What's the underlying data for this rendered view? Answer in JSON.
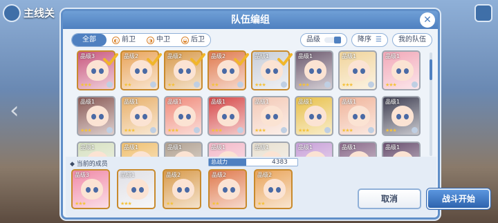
{
  "background": {
    "title": "主线关"
  },
  "dialog": {
    "title": "队伍编组",
    "tabs": [
      {
        "label": "全部",
        "active": true
      },
      {
        "label": "前卫"
      },
      {
        "label": "中卫"
      },
      {
        "label": "后卫"
      }
    ],
    "filters": {
      "rank_label": "品级",
      "sort_label": "降序",
      "myteam_label": "我的队伍"
    },
    "characters": [
      {
        "level": "品级3",
        "stars": "★★★",
        "selected": true,
        "bg": "#c9577e"
      },
      {
        "level": "品级2",
        "stars": "★★",
        "selected": true,
        "bg": "#e9a45a"
      },
      {
        "level": "品级2",
        "stars": "★★",
        "selected": true,
        "bg": "#d89a4b"
      },
      {
        "level": "品级2",
        "stars": "★★",
        "selected": true,
        "bg": "#e07a4e"
      },
      {
        "level": "品级1",
        "stars": "★★★",
        "selected": true,
        "bg": "#c9ced8"
      },
      {
        "level": "品级1",
        "stars": "★★★",
        "selected": false,
        "bg": "#6d5a6f"
      },
      {
        "level": "品级1",
        "stars": "★★★",
        "selected": false,
        "bg": "#f1d49b"
      },
      {
        "level": "品级1",
        "stars": "★★★",
        "selected": false,
        "bg": "#f2a8b8"
      },
      {
        "level": "品级1",
        "stars": "★★★",
        "selected": false,
        "bg": "#8a5a55"
      },
      {
        "level": "品级1",
        "stars": "★★★",
        "selected": false,
        "bg": "#e8b06a"
      },
      {
        "level": "品级1",
        "stars": "★★★",
        "selected": false,
        "bg": "#f08a7a"
      },
      {
        "level": "品级1",
        "stars": "★★★",
        "selected": false,
        "bg": "#d64848"
      },
      {
        "level": "品级1",
        "stars": "★★★",
        "selected": false,
        "bg": "#f3c9b6"
      },
      {
        "level": "品级1",
        "stars": "★★★",
        "selected": false,
        "bg": "#e8c04a"
      },
      {
        "level": "品级1",
        "stars": "★★★",
        "selected": false,
        "bg": "#f0b49a"
      },
      {
        "level": "品级1",
        "stars": "★★★",
        "selected": false,
        "bg": "#3f3f52"
      },
      {
        "level": "品级1",
        "stars": "",
        "selected": false,
        "bg": "#d6e0c0"
      },
      {
        "level": "品级1",
        "stars": "",
        "selected": false,
        "bg": "#f0c070"
      },
      {
        "level": "品级1",
        "stars": "",
        "selected": false,
        "bg": "#b0a090"
      },
      {
        "level": "品级1",
        "stars": "",
        "selected": false,
        "bg": "#f3b8c8"
      },
      {
        "level": "品级1",
        "stars": "",
        "selected": false,
        "bg": "#e8e0d0"
      },
      {
        "level": "品级1",
        "stars": "",
        "selected": false,
        "bg": "#c8a0d8"
      },
      {
        "level": "品级1",
        "stars": "",
        "selected": false,
        "bg": "#8a6a8a"
      },
      {
        "level": "品级1",
        "stars": "",
        "selected": false,
        "bg": "#6a5070"
      }
    ],
    "current": {
      "label": "当前的成员",
      "power_label": "总战力",
      "power_value": "4383",
      "members": [
        {
          "level": "品级3",
          "stars": "★★★",
          "bg": "#f08aa8"
        },
        {
          "level": "品级1",
          "stars": "★★★",
          "bg": "#e0e0e6"
        },
        {
          "level": "品级2",
          "stars": "★★",
          "bg": "#d89a4b"
        },
        {
          "level": "品级2",
          "stars": "★★",
          "bg": "#e07a4e"
        },
        {
          "level": "品级2",
          "stars": "★★",
          "bg": "#e9a45a"
        }
      ]
    },
    "buttons": {
      "cancel": "取消",
      "start": "战斗开始"
    }
  }
}
